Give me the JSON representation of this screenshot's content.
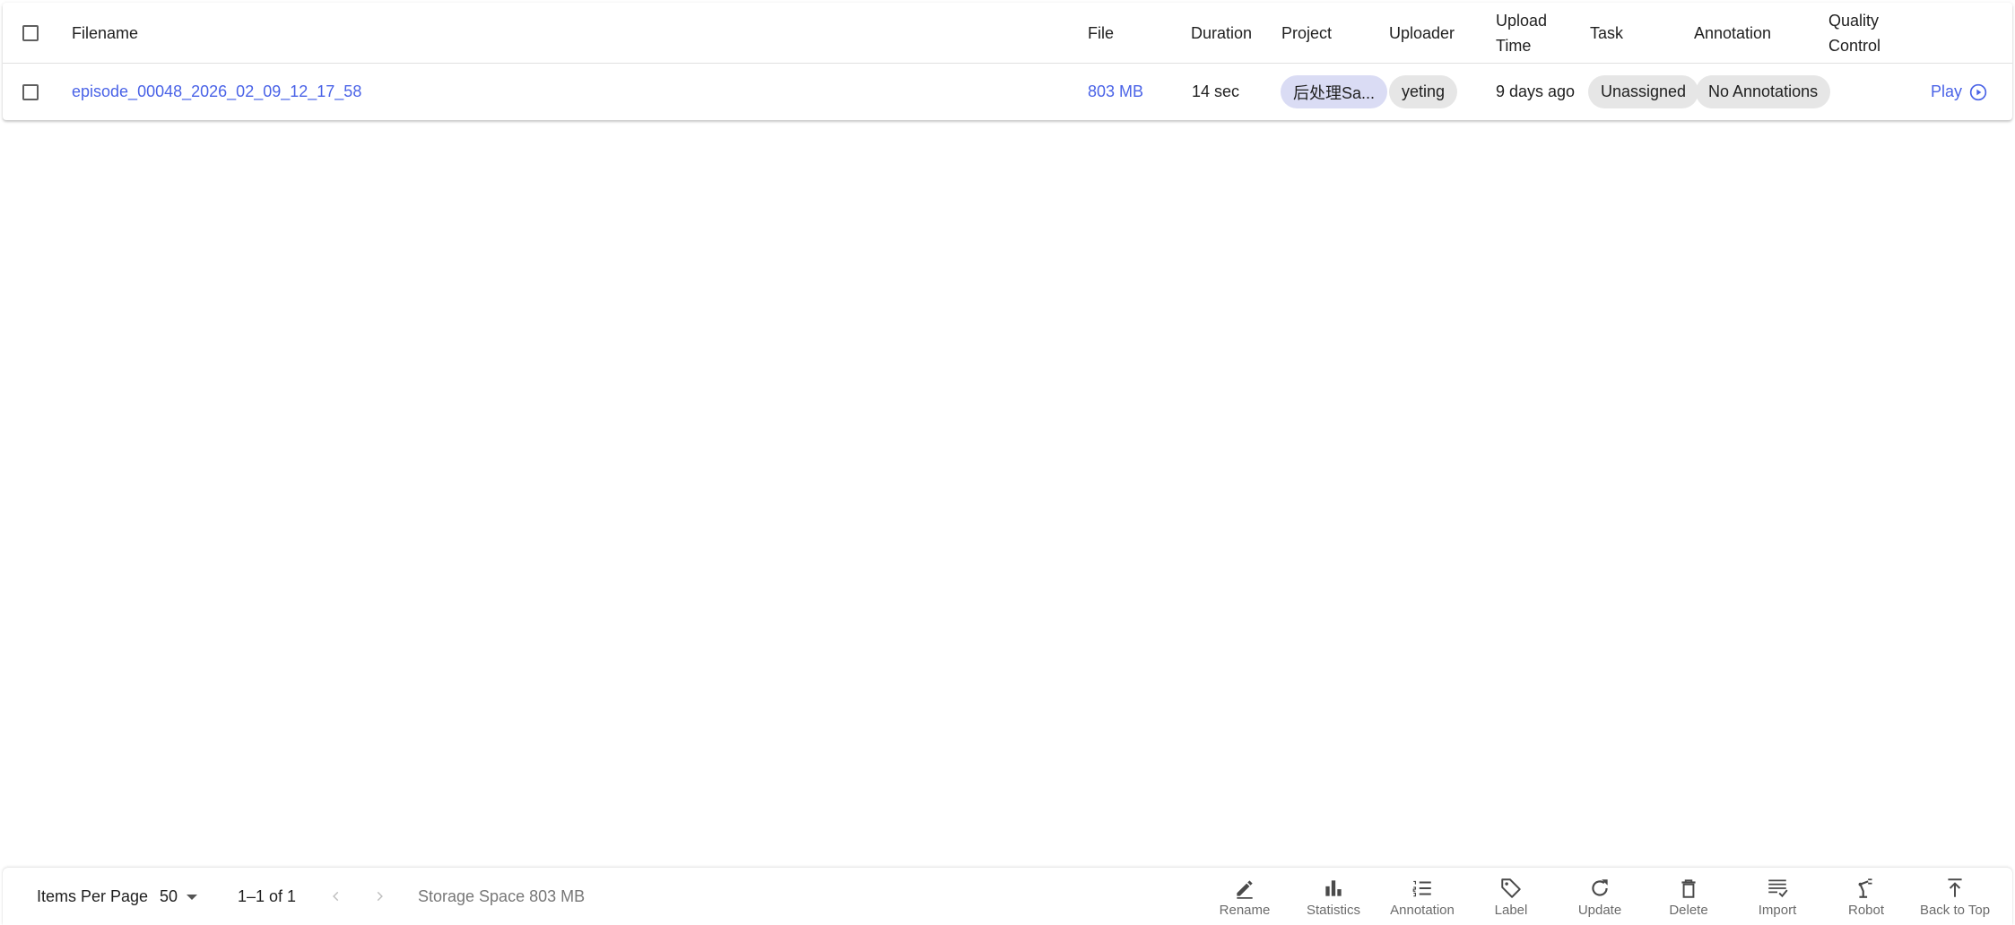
{
  "table": {
    "headers": {
      "filename": "Filename",
      "file": "File",
      "duration": "Duration",
      "project": "Project",
      "uploader": "Uploader",
      "upload_time_line1": "Upload",
      "upload_time_line2": "Time",
      "task": "Task",
      "annotation": "Annotation",
      "quality_line1": "Quality",
      "quality_line2": "Control"
    },
    "rows": [
      {
        "filename": "episode_00048_2026_02_09_12_17_58",
        "file": "803 MB",
        "duration": "14 sec",
        "project": "后处理Sa...",
        "uploader": "yeting",
        "upload_time": "9 days ago",
        "task": "Unassigned",
        "annotation": "No Annotations",
        "action": "Play"
      }
    ]
  },
  "footer": {
    "items_per_page_label": "Items Per Page",
    "items_per_page_value": "50",
    "range": "1–1 of 1",
    "storage": "Storage Space 803 MB",
    "tools": [
      {
        "label": "Rename",
        "icon": "pencil-icon"
      },
      {
        "label": "Statistics",
        "icon": "bar-chart-icon"
      },
      {
        "label": "Annotation",
        "icon": "list-icon"
      },
      {
        "label": "Label",
        "icon": "tag-icon"
      },
      {
        "label": "Update",
        "icon": "refresh-icon"
      },
      {
        "label": "Delete",
        "icon": "trash-icon"
      },
      {
        "label": "Import",
        "icon": "import-icon"
      },
      {
        "label": "Robot",
        "icon": "robot-arm-icon"
      },
      {
        "label": "Back to Top",
        "icon": "arrow-top-icon"
      }
    ]
  },
  "colors": {
    "link": "#4a63e7",
    "chip": "#e6e6e6",
    "project_chip": "#dadcf4"
  }
}
